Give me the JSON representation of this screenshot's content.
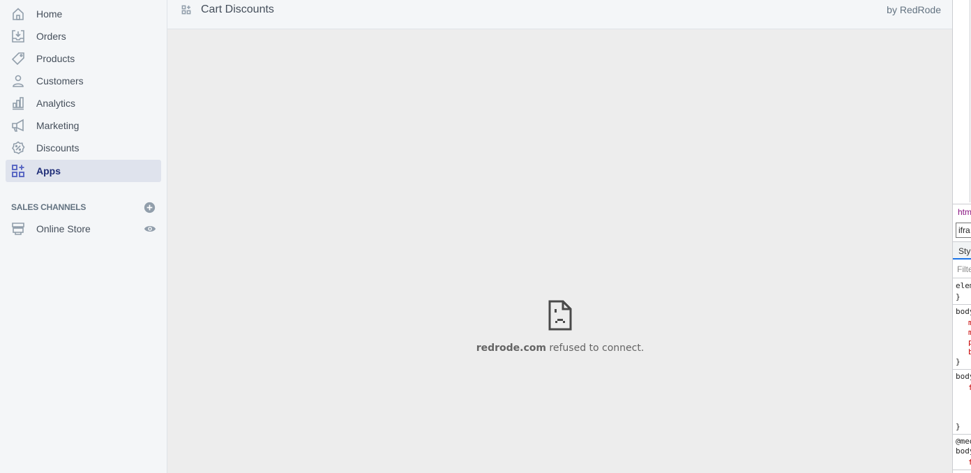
{
  "sidebar": {
    "items": [
      {
        "label": "Home",
        "icon": "home-icon",
        "active": false
      },
      {
        "label": "Orders",
        "icon": "orders-icon",
        "active": false
      },
      {
        "label": "Products",
        "icon": "tag-icon",
        "active": false
      },
      {
        "label": "Customers",
        "icon": "person-icon",
        "active": false
      },
      {
        "label": "Analytics",
        "icon": "bar-chart-icon",
        "active": false
      },
      {
        "label": "Marketing",
        "icon": "megaphone-icon",
        "active": false
      },
      {
        "label": "Discounts",
        "icon": "discount-icon",
        "active": false
      },
      {
        "label": "Apps",
        "icon": "apps-icon",
        "active": true
      }
    ],
    "sales_channels": {
      "title": "SALES CHANNELS",
      "add_icon": "plus-circle-icon",
      "items": [
        {
          "label": "Online Store",
          "icon": "store-icon",
          "action_icon": "eye-icon"
        }
      ]
    }
  },
  "topbar": {
    "app_icon": "apps-icon",
    "title": "Cart Discounts",
    "byline": "by RedRode"
  },
  "error": {
    "icon": "sad-document-icon",
    "domain": "redrode.com",
    "message": " refused to connect."
  },
  "devtools": {
    "breadcrumb": "html",
    "selected": "ifra",
    "tab": "Sty",
    "filter_placeholder": "Filte",
    "lines": {
      "l1": "elem",
      "l2": "}",
      "l3": "body",
      "l4": "m",
      "l5": "m",
      "l6": "p",
      "l7": "b",
      "l8": "}",
      "l9": "body",
      "l10": "f",
      "l11": "}",
      "l12": "@med",
      "l13": "body",
      "l14": "f"
    }
  },
  "colors": {
    "active_bg": "#dfe3ed",
    "active_text": "#202e78",
    "accent_icon": "#5c6ac4",
    "text": "#454f5b",
    "muted": "#637381"
  }
}
